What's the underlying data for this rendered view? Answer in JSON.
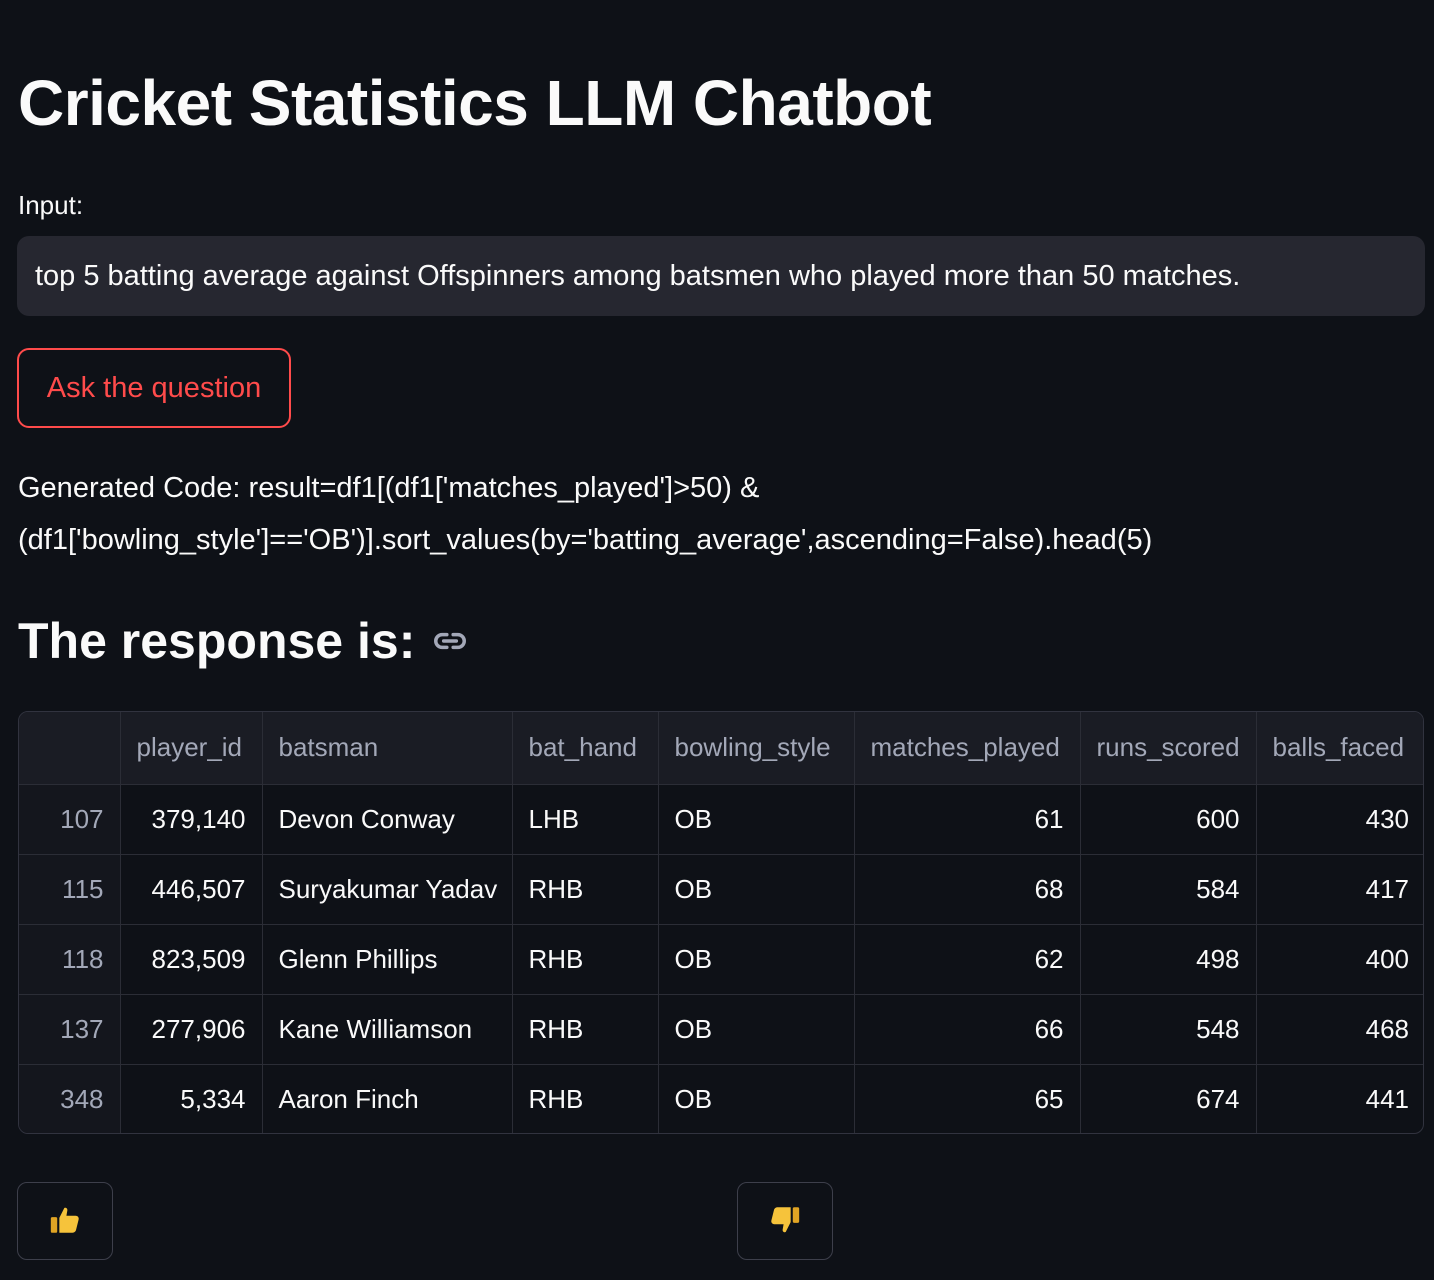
{
  "title": "Cricket Statistics LLM Chatbot",
  "input": {
    "label": "Input:",
    "value": "top 5 batting average against Offspinners among batsmen who played more than 50 matches."
  },
  "ask_button_label": "Ask the question",
  "generated_code": {
    "line1": "Generated Code: result=df1[(df1['matches_played']>50) &",
    "line2": "(df1['bowling_style']=='OB')].sort_values(by='batting_average',ascending=False).head(5)"
  },
  "response_heading": "The response is:",
  "icons": {
    "heading_link": "link-icon",
    "feedback_up": "thumbs-up-icon",
    "feedback_down": "thumbs-down-icon"
  },
  "colors": {
    "background": "#0e1117",
    "accent": "#ff4b4b",
    "input_bg": "#262730",
    "emoji_yellow": "#f6c33b"
  },
  "table": {
    "columns": [
      "",
      "player_id",
      "batsman",
      "bat_hand",
      "bowling_style",
      "matches_played",
      "runs_scored",
      "balls_faced"
    ],
    "rows": [
      {
        "index": "107",
        "player_id": "379,140",
        "batsman": "Devon Conway",
        "bat_hand": "LHB",
        "bowling_style": "OB",
        "matches_played": "61",
        "runs_scored": "600",
        "balls_faced": "430"
      },
      {
        "index": "115",
        "player_id": "446,507",
        "batsman": "Suryakumar Yadav",
        "bat_hand": "RHB",
        "bowling_style": "OB",
        "matches_played": "68",
        "runs_scored": "584",
        "balls_faced": "417"
      },
      {
        "index": "118",
        "player_id": "823,509",
        "batsman": "Glenn Phillips",
        "bat_hand": "RHB",
        "bowling_style": "OB",
        "matches_played": "62",
        "runs_scored": "498",
        "balls_faced": "400"
      },
      {
        "index": "137",
        "player_id": "277,906",
        "batsman": "Kane Williamson",
        "bat_hand": "RHB",
        "bowling_style": "OB",
        "matches_played": "66",
        "runs_scored": "548",
        "balls_faced": "468"
      },
      {
        "index": "348",
        "player_id": "5,334",
        "batsman": "Aaron Finch",
        "bat_hand": "RHB",
        "bowling_style": "OB",
        "matches_played": "65",
        "runs_scored": "674",
        "balls_faced": "441"
      }
    ]
  }
}
